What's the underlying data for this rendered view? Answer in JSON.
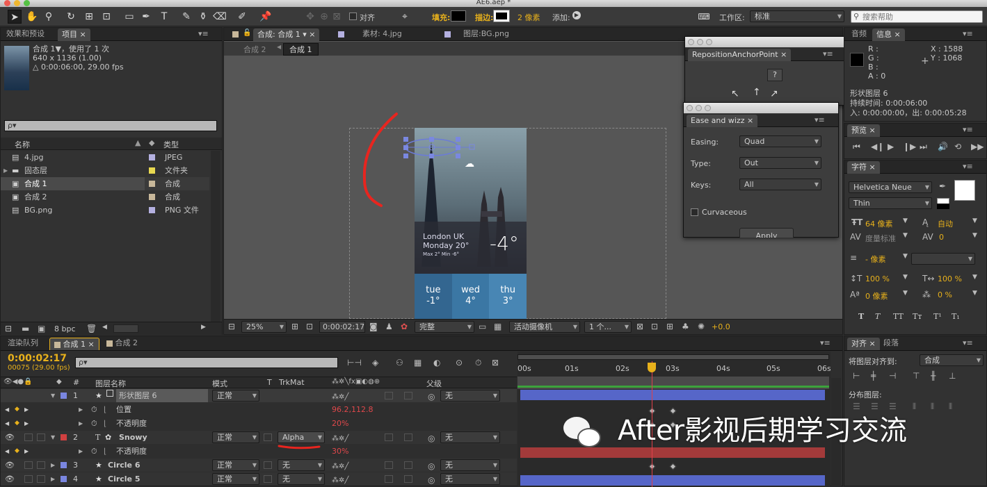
{
  "window": {
    "title": "AE6.aep *"
  },
  "toolbar": {
    "align_label": "对齐",
    "fill_label": "填充:",
    "stroke_label": "描边:",
    "stroke_width": "2 像素",
    "add_label": "添加:",
    "workspace_label": "工作区:",
    "workspace_value": "标准",
    "search_placeholder": "搜索帮助"
  },
  "left_panel": {
    "tabs": [
      "效果和预设",
      "项目"
    ],
    "comp_name": "合成 1▼，使用了 1 次",
    "comp_size": "640 x 1136 (1.00)",
    "comp_duration": "△ 0:00:06:00, 29.00 fps",
    "search_value": "ρ▾",
    "col_name": "名称",
    "col_type": "类型",
    "items": [
      {
        "name": "4.jpg",
        "type": "JPEG",
        "color": "#b4b0e0"
      },
      {
        "name": "固态层",
        "type": "文件夹",
        "color": "#e8d850"
      },
      {
        "name": "合成 1",
        "type": "合成",
        "color": "#c8b89a"
      },
      {
        "name": "合成 2",
        "type": "合成",
        "color": "#c8b89a"
      },
      {
        "name": "BG.png",
        "type": "PNG 文件",
        "color": "#b4b0e0"
      }
    ],
    "bpc": "8 bpc"
  },
  "viewer": {
    "tabs": [
      "合成: 合成 1",
      "素材: 4.jpg",
      "图层:BG.png"
    ],
    "breadcrumb": [
      "合成 2",
      "合成 1"
    ],
    "zoom": "25%",
    "time": "0:00:02:17",
    "quality": "完整",
    "camera": "活动摄像机",
    "views": "1 个...",
    "exposure": "+0.0"
  },
  "phone": {
    "city": "London UK",
    "day": "Monday 20°",
    "range": "Max 2° Min -6°",
    "temp": "-4°",
    "forecast": [
      {
        "day": "tue",
        "t": "-1°"
      },
      {
        "day": "wed",
        "t": "4°"
      },
      {
        "day": "thu",
        "t": "3°"
      }
    ]
  },
  "reposition_window": {
    "title": "RepositionAnchorPoint",
    "help": "?"
  },
  "ease_window": {
    "title": "Ease and wizz",
    "easing_label": "Easing:",
    "easing_value": "Quad",
    "type_label": "Type:",
    "type_value": "Out",
    "keys_label": "Keys:",
    "keys_value": "All",
    "curvaceous_label": "Curvaceous",
    "apply_label": "Apply"
  },
  "info_panel": {
    "tabs": [
      "音频",
      "信息"
    ],
    "r": "R :",
    "g": "G :",
    "b": "B :",
    "a": "A : 0",
    "x": "X : 1588",
    "y": "Y : 1068",
    "layer": "形状图层 6",
    "duration": "持续时间: 0:00:06:00",
    "in_out": "入: 0:00:00:00，出: 0:00:05:28"
  },
  "preview_panel": {
    "tab": "预览"
  },
  "char_panel": {
    "tab": "字符",
    "font": "Helvetica Neue",
    "style": "Thin",
    "size": "64 像素",
    "leading": "自动",
    "kerning": "度量标准",
    "tracking": "0",
    "stroke": "- 像素",
    "vscale": "100 %",
    "hscale": "100 %",
    "baseline": "0 像素",
    "tsume": "0 %"
  },
  "align_panel": {
    "tabs": [
      "对齐",
      "段落"
    ],
    "align_to_label": "将图层对齐到:",
    "align_to_value": "合成",
    "distribute_label": "分布图层:"
  },
  "timeline": {
    "tabs": [
      "渲染队列",
      "合成 1",
      "合成 2"
    ],
    "time": "0:00:02:17",
    "frames": "00075 (29.00 fps)",
    "search_value": "ρ▾",
    "col_num": "#",
    "col_name": "图层名称",
    "col_mode": "模式",
    "col_t": "T",
    "col_trkmat": "TrkMat",
    "col_parent": "父级",
    "ruler": [
      "00s",
      "01s",
      "02s",
      "03s",
      "04s",
      "05s",
      "06s"
    ],
    "layers": [
      {
        "num": "1",
        "name": "形状图层 6",
        "mode": "正常",
        "parent": "无",
        "color": "#7a86e0",
        "icon": "★"
      },
      {
        "prop": "位置",
        "value": "96.2,112.8"
      },
      {
        "prop": "不透明度",
        "value": "20%"
      },
      {
        "num": "2",
        "name": "Snowy",
        "mode": "正常",
        "trkmat": "Alpha",
        "parent": "无",
        "color": "#d04040",
        "icon": "T"
      },
      {
        "prop": "不透明度",
        "value": "30%"
      },
      {
        "num": "3",
        "name": "Circle 6",
        "mode": "正常",
        "trkmat": "无",
        "parent": "无",
        "color": "#7a86e0",
        "icon": "★"
      },
      {
        "num": "4",
        "name": "Circle 5",
        "mode": "正常",
        "trkmat": "无",
        "parent": "无",
        "color": "#7a86e0",
        "icon": "★"
      }
    ]
  },
  "watermark": "After影视后期学习交流"
}
